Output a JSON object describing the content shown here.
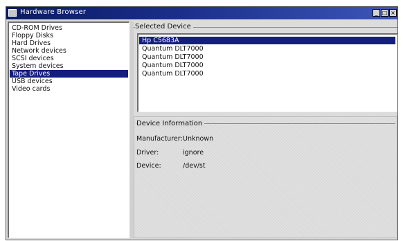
{
  "window": {
    "title": "Hardware Browser",
    "controls": {
      "minimize": "_",
      "maximize": "□",
      "close": "×"
    }
  },
  "categories": {
    "items": [
      "CD-ROM Drives",
      "Floppy Disks",
      "Hard Drives",
      "Network devices",
      "SCSI devices",
      "System devices",
      "Tape Drives",
      "USB devices",
      "Video cards"
    ],
    "selected": "Tape Drives"
  },
  "selected_device": {
    "label": "Selected Device",
    "items": [
      "Hp C5683A",
      "Quantum DLT7000",
      "Quantum DLT7000",
      "Quantum DLT7000",
      "Quantum DLT7000"
    ],
    "selected": "Hp C5683A"
  },
  "device_information": {
    "label": "Device Information",
    "manufacturer_label": "Manufacturer:",
    "manufacturer_value": "Unknown",
    "driver_label": "Driver:",
    "driver_value": "ignore",
    "device_label": "Device:",
    "device_value": "/dev/st"
  },
  "colors": {
    "titlebar": "#1b2f8a",
    "selection": "#141e80",
    "panel": "#dcdcdc"
  }
}
